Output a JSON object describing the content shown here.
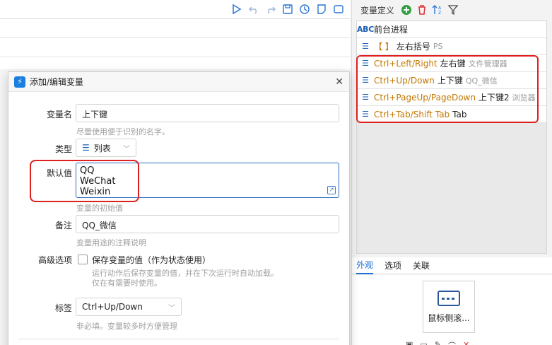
{
  "toolbar": {
    "icons": [
      "run-icon",
      "undo-icon",
      "redo-icon",
      "save-icon",
      "history-icon",
      "note-icon",
      "more-icon"
    ]
  },
  "variables_panel": {
    "title": "变量定义",
    "items": [
      {
        "icon": "ABC",
        "key": "",
        "name": "前台进程",
        "note": ""
      },
      {
        "icon": "list",
        "key": "【 】",
        "name": "左右括号",
        "note": "PS"
      },
      {
        "icon": "list",
        "key": "Ctrl+Left/Right",
        "name": "左右键",
        "note": "文件管理器"
      },
      {
        "icon": "list",
        "key": "Ctrl+Up/Down",
        "name": "上下键",
        "note": "QQ_微信"
      },
      {
        "icon": "list",
        "key": "Ctrl+PageUp/PageDown",
        "name": "上下键2",
        "note": "浏览器"
      },
      {
        "icon": "list",
        "key": "Ctrl+Tab/Shift Tab",
        "name": "Tab",
        "note": ""
      }
    ],
    "tabs": [
      "外观",
      "选项",
      "关联"
    ],
    "active_tab": "外观",
    "appearance_card_label": "鼠标侧滚..."
  },
  "dialog": {
    "title": "添加/编辑变量",
    "name_label": "变量名",
    "name_value": "上下键",
    "name_hint": "尽量使用便于识别的名字。",
    "type_label": "类型",
    "type_value": "列表",
    "default_label": "默认值",
    "default_lines": [
      "QQ",
      "WeChat",
      "Weixin"
    ],
    "default_hint": "变量的初始值",
    "remark_label": "备注",
    "remark_value": "QQ_微信",
    "remark_hint": "变量用途的注释说明",
    "advanced_label": "高级选项",
    "save_state_label": "保存变量的值（作为状态使用）",
    "save_state_checked": false,
    "save_state_hint1": "运行动作后保存变量的值，并在下次运行时自动加载。",
    "save_state_hint2": "仅在有需要时使用。",
    "tag_label": "标签",
    "tag_value": "Ctrl+Up/Down",
    "tag_hint": "非必填。变量较多时方便管理"
  },
  "colors": {
    "accent": "#1a6fd0",
    "key_orange": "#c27700",
    "annotation_red": "#e02020",
    "add_green": "#2ea043",
    "delete_red": "#d9363e"
  }
}
